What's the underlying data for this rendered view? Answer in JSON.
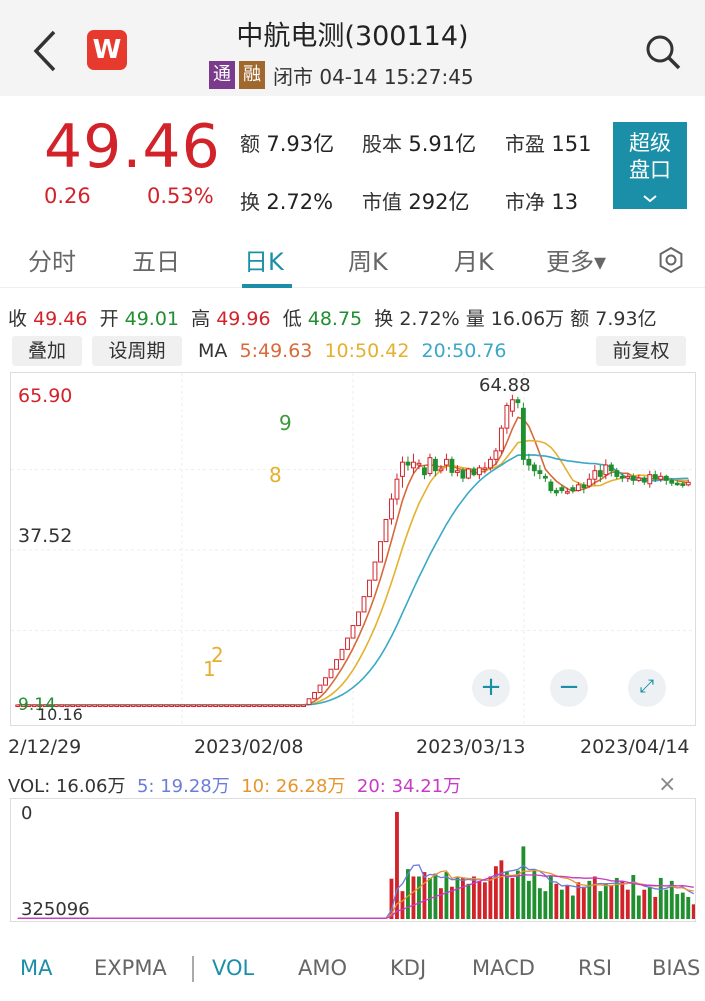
{
  "header": {
    "title": "中航电测(300114)",
    "tag1": "通",
    "tag2": "融",
    "status": "闭市 04-14 15:27:45",
    "logo_letter": "W"
  },
  "quote": {
    "price": "49.46",
    "change": "0.26",
    "change_pct": "0.53%",
    "amount_label": "额",
    "amount": "7.93亿",
    "share_label": "股本",
    "share": "5.91亿",
    "pe_label": "市盈",
    "pe": "151",
    "turnover_label": "换",
    "turnover": "2.72%",
    "mcap_label": "市值",
    "mcap": "292亿",
    "pb_label": "市净",
    "pb": "13",
    "super_label1": "超级",
    "super_label2": "盘口"
  },
  "tabs": [
    "分时",
    "五日",
    "日K",
    "周K",
    "月K",
    "更多▾"
  ],
  "ohlc": {
    "close_label": "收",
    "close": "49.46",
    "open_label": "开",
    "open": "49.01",
    "high_label": "高",
    "high": "49.96",
    "low_label": "低",
    "low": "48.75",
    "turn_label": "换",
    "turn": "2.72%",
    "vol_label": "量",
    "vol": "16.06万",
    "amt_label": "额",
    "amt": "7.93亿"
  },
  "toolbar": {
    "overlay": "叠加",
    "period": "设周期",
    "ma_label": "MA",
    "ma5": "5:49.63",
    "ma10": "10:50.42",
    "ma20": "20:50.76",
    "adjust": "前复权"
  },
  "chart_labels": {
    "y_high": "65.90",
    "y_mid": "37.52",
    "y_low": "9.14",
    "min_marker": "10.16",
    "max_marker": "64.88",
    "marker_9": "9",
    "marker_8": "8",
    "marker_2": "2",
    "marker_1": "1"
  },
  "dates": [
    "2/12/29",
    "2023/02/08",
    "2023/03/13",
    "2023/04/14"
  ],
  "vol_legend": {
    "vol": "VOL: 16.06万",
    "m5": "5: 19.28万",
    "m10": "10: 26.28万",
    "m20": "20: 34.21万",
    "y_top": "0",
    "y_bottom": "325096"
  },
  "bottom_tabs": [
    "MA",
    "EXPMA",
    "VOL",
    "AMO",
    "KDJ",
    "MACD",
    "RSI",
    "BIAS"
  ],
  "colors": {
    "up": "#d2232a",
    "down": "#1f8f2f",
    "accent": "#1c8fa8",
    "ma5": "#d86a3a",
    "ma10": "#e5b02e",
    "ma20": "#3aa8c8"
  },
  "chart_data": {
    "type": "candlestick",
    "note_axis": "daily K line, price range 9.14 to 65.90",
    "ylim": [
      9.14,
      65.9
    ],
    "candles": [
      [
        10.2,
        10.2,
        10.1,
        10.3
      ],
      [
        10.2,
        10.2,
        10.1,
        10.3
      ],
      [
        10.2,
        10.2,
        10.1,
        10.3
      ],
      [
        10.2,
        10.2,
        10.1,
        10.3
      ],
      [
        10.2,
        10.2,
        10.1,
        10.3
      ],
      [
        10.2,
        10.2,
        10.1,
        10.3
      ],
      [
        10.2,
        10.2,
        10.1,
        10.3
      ],
      [
        10.2,
        10.2,
        10.1,
        10.3
      ],
      [
        10.2,
        10.2,
        10.1,
        10.3
      ],
      [
        10.2,
        10.2,
        10.1,
        10.3
      ],
      [
        10.2,
        10.2,
        10.1,
        10.3
      ],
      [
        10.2,
        10.2,
        10.1,
        10.3
      ],
      [
        10.2,
        10.2,
        10.1,
        10.3
      ],
      [
        10.2,
        10.2,
        10.1,
        10.3
      ],
      [
        10.2,
        10.2,
        10.1,
        10.3
      ],
      [
        10.2,
        10.2,
        10.1,
        10.3
      ],
      [
        10.2,
        10.2,
        10.1,
        10.3
      ],
      [
        10.2,
        10.2,
        10.1,
        10.3
      ],
      [
        10.2,
        10.2,
        10.1,
        10.3
      ],
      [
        10.2,
        10.2,
        10.1,
        10.3
      ],
      [
        10.2,
        10.2,
        10.1,
        10.3
      ],
      [
        10.2,
        10.2,
        10.1,
        10.3
      ],
      [
        10.2,
        10.2,
        10.1,
        10.3
      ],
      [
        10.2,
        10.2,
        10.1,
        10.3
      ],
      [
        10.2,
        10.2,
        10.1,
        10.3
      ],
      [
        10.2,
        10.2,
        10.1,
        10.3
      ],
      [
        10.2,
        10.2,
        10.1,
        10.3
      ],
      [
        10.2,
        10.2,
        10.1,
        10.3
      ],
      [
        10.2,
        10.2,
        10.1,
        10.3
      ],
      [
        10.2,
        10.2,
        10.1,
        10.3
      ],
      [
        10.2,
        10.2,
        10.1,
        10.3
      ],
      [
        10.2,
        10.2,
        10.1,
        10.3
      ],
      [
        10.2,
        10.2,
        10.1,
        10.3
      ],
      [
        10.2,
        10.2,
        10.1,
        10.3
      ],
      [
        10.2,
        10.2,
        10.1,
        10.3
      ],
      [
        10.2,
        10.2,
        10.1,
        10.3
      ],
      [
        10.2,
        10.2,
        10.1,
        10.3
      ],
      [
        10.2,
        10.2,
        10.1,
        10.3
      ],
      [
        10.2,
        10.2,
        10.1,
        10.3
      ],
      [
        10.2,
        10.2,
        10.1,
        10.3
      ],
      [
        10.2,
        10.2,
        10.1,
        10.3
      ],
      [
        10.2,
        10.2,
        10.1,
        10.3
      ],
      [
        10.2,
        10.2,
        10.1,
        10.3
      ],
      [
        10.2,
        10.2,
        10.1,
        10.3
      ],
      [
        10.2,
        10.2,
        10.1,
        10.3
      ],
      [
        10.2,
        10.2,
        10.1,
        10.3
      ],
      [
        10.2,
        10.2,
        10.1,
        10.3
      ],
      [
        10.2,
        10.2,
        10.1,
        10.3
      ],
      [
        10.2,
        10.2,
        10.1,
        10.3
      ],
      [
        10.2,
        10.2,
        10.1,
        10.3
      ],
      [
        10.2,
        10.2,
        10.1,
        10.3
      ],
      [
        10.2,
        10.2,
        10.1,
        10.3
      ],
      [
        10.2,
        10.2,
        10.1,
        10.3
      ],
      [
        10.3,
        11.3,
        10.3,
        11.3
      ],
      [
        11.3,
        12.4,
        11.3,
        12.4
      ],
      [
        12.4,
        13.7,
        12.4,
        13.7
      ],
      [
        13.7,
        15.0,
        13.7,
        15.0
      ],
      [
        15.0,
        16.5,
        15.0,
        16.5
      ],
      [
        16.5,
        18.2,
        16.5,
        18.2
      ],
      [
        18.2,
        20.0,
        18.2,
        20.0
      ],
      [
        20.0,
        22.0,
        20.0,
        22.0
      ],
      [
        22.0,
        24.2,
        22.0,
        24.2
      ],
      [
        24.2,
        26.6,
        24.2,
        26.6
      ],
      [
        26.6,
        29.3,
        26.6,
        29.3
      ],
      [
        29.3,
        32.2,
        29.3,
        32.2
      ],
      [
        32.2,
        35.4,
        32.2,
        35.4
      ],
      [
        35.4,
        39.0,
        35.4,
        39.0
      ],
      [
        39.0,
        42.9,
        39.0,
        42.9
      ],
      [
        43.0,
        46.5,
        42.0,
        47.5
      ],
      [
        46.5,
        50.0,
        45.5,
        51.0
      ],
      [
        50.5,
        53.0,
        48.5,
        54.0
      ],
      [
        53.0,
        52.5,
        51.5,
        54.0
      ],
      [
        52.0,
        53.0,
        51.0,
        54.5
      ],
      [
        52.5,
        52.8,
        51.8,
        53.5
      ],
      [
        52.0,
        50.8,
        50.0,
        52.5
      ],
      [
        51.0,
        53.8,
        50.5,
        54.5
      ],
      [
        53.5,
        51.5,
        50.5,
        54.0
      ],
      [
        51.5,
        51.8,
        51.0,
        52.5
      ],
      [
        52.5,
        53.5,
        51.5,
        54.5
      ],
      [
        53.5,
        51.2,
        50.5,
        54.0
      ],
      [
        51.2,
        51.5,
        50.5,
        52.5
      ],
      [
        51.5,
        50.2,
        49.5,
        52.0
      ],
      [
        50.2,
        51.8,
        50.0,
        52.0
      ],
      [
        51.8,
        50.8,
        50.5,
        52.2
      ],
      [
        50.8,
        52.0,
        50.0,
        52.5
      ],
      [
        52.0,
        52.0,
        51.0,
        53.0
      ],
      [
        52.0,
        53.5,
        51.5,
        54.0
      ],
      [
        53.5,
        55.0,
        52.5,
        55.5
      ],
      [
        55.0,
        59.0,
        54.5,
        59.5
      ],
      [
        59.0,
        63.0,
        58.0,
        63.5
      ],
      [
        62.0,
        64.0,
        61.0,
        64.88
      ],
      [
        64.0,
        63.5,
        62.5,
        64.5
      ],
      [
        62.5,
        53.5,
        52.5,
        63.5
      ],
      [
        53.5,
        52.5,
        51.5,
        54.5
      ],
      [
        52.5,
        51.5,
        50.5,
        53.0
      ],
      [
        51.5,
        51.0,
        50.0,
        52.5
      ],
      [
        50.5,
        50.2,
        49.5,
        51.0
      ],
      [
        49.5,
        48.0,
        47.5,
        50.0
      ],
      [
        48.0,
        47.6,
        47.0,
        48.5
      ],
      [
        48.5,
        48.0,
        47.5,
        49.0
      ],
      [
        47.8,
        47.8,
        47.3,
        48.5
      ],
      [
        48.5,
        48.0,
        47.5,
        49.0
      ],
      [
        48.0,
        49.0,
        47.8,
        49.5
      ],
      [
        49.0,
        48.5,
        47.5,
        49.5
      ],
      [
        48.8,
        50.0,
        48.5,
        51.0
      ],
      [
        50.0,
        51.5,
        49.0,
        52.5
      ],
      [
        51.5,
        50.5,
        49.5,
        52.5
      ],
      [
        50.8,
        52.5,
        50.0,
        53.5
      ],
      [
        52.5,
        51.5,
        50.5,
        53.0
      ],
      [
        51.5,
        50.5,
        50.0,
        52.0
      ],
      [
        50.5,
        50.2,
        49.5,
        51.0
      ],
      [
        50.2,
        50.5,
        49.5,
        51.0
      ],
      [
        50.5,
        49.8,
        49.0,
        51.0
      ],
      [
        49.8,
        50.2,
        49.5,
        50.8
      ],
      [
        50.2,
        49.5,
        49.0,
        50.5
      ],
      [
        49.2,
        50.8,
        48.5,
        51.5
      ],
      [
        50.8,
        50.0,
        49.5,
        51.5
      ],
      [
        50.0,
        50.5,
        49.5,
        51.2
      ],
      [
        50.5,
        49.8,
        49.0,
        50.8
      ],
      [
        49.8,
        49.3,
        48.8,
        50.2
      ],
      [
        49.3,
        49.2,
        48.8,
        49.8
      ],
      [
        49.2,
        48.9,
        48.5,
        49.5
      ],
      [
        49.01,
        49.46,
        48.75,
        49.96
      ]
    ],
    "volume": [
      1,
      1,
      1,
      1,
      1,
      1,
      1,
      1,
      1,
      1,
      1,
      1,
      1,
      1,
      1,
      1,
      1,
      1,
      1,
      1,
      1,
      1,
      1,
      1,
      1,
      1,
      1,
      1,
      1,
      1,
      1,
      1,
      1,
      1,
      1,
      1,
      1,
      1,
      1,
      1,
      1,
      1,
      1,
      1,
      1,
      1,
      1,
      1,
      1,
      1,
      1,
      1,
      1,
      1,
      1,
      1,
      1,
      1,
      1,
      1,
      1,
      1,
      1,
      1,
      1,
      1,
      1,
      1,
      55,
      146,
      38,
      68,
      58,
      58,
      64,
      56,
      62,
      42,
      64,
      44,
      58,
      56,
      48,
      58,
      52,
      50,
      58,
      72,
      80,
      64,
      56,
      66,
      99,
      52,
      66,
      42,
      38,
      58,
      48,
      40,
      46,
      32,
      50,
      44,
      52,
      58,
      38,
      48,
      46,
      56,
      52,
      40,
      60,
      32,
      40,
      44,
      30,
      56,
      40,
      52,
      34,
      36,
      30,
      20
    ],
    "volume_up": [
      0,
      0,
      0,
      0,
      0,
      0,
      0,
      0,
      0,
      0,
      0,
      0,
      0,
      0,
      0,
      0,
      0,
      0,
      0,
      0,
      0,
      0,
      0,
      0,
      0,
      0,
      0,
      0,
      0,
      0,
      0,
      0,
      0,
      0,
      0,
      0,
      0,
      0,
      0,
      0,
      0,
      0,
      0,
      0,
      0,
      0,
      0,
      0,
      0,
      0,
      0,
      0,
      0,
      1,
      1,
      1,
      1,
      1,
      1,
      1,
      1,
      1,
      1,
      1,
      1,
      1,
      1,
      1,
      1,
      1,
      1,
      0,
      1,
      0,
      1,
      0,
      0,
      1,
      0,
      1,
      0,
      1,
      0,
      1,
      1,
      1,
      1,
      1,
      1,
      0,
      1,
      0,
      0,
      0,
      0,
      0,
      0,
      0,
      1,
      0,
      1,
      0,
      1,
      1,
      0,
      1,
      0,
      0,
      1,
      0,
      1,
      1,
      0,
      0,
      1,
      0,
      1,
      0,
      0,
      0,
      0,
      0,
      0,
      1
    ]
  }
}
